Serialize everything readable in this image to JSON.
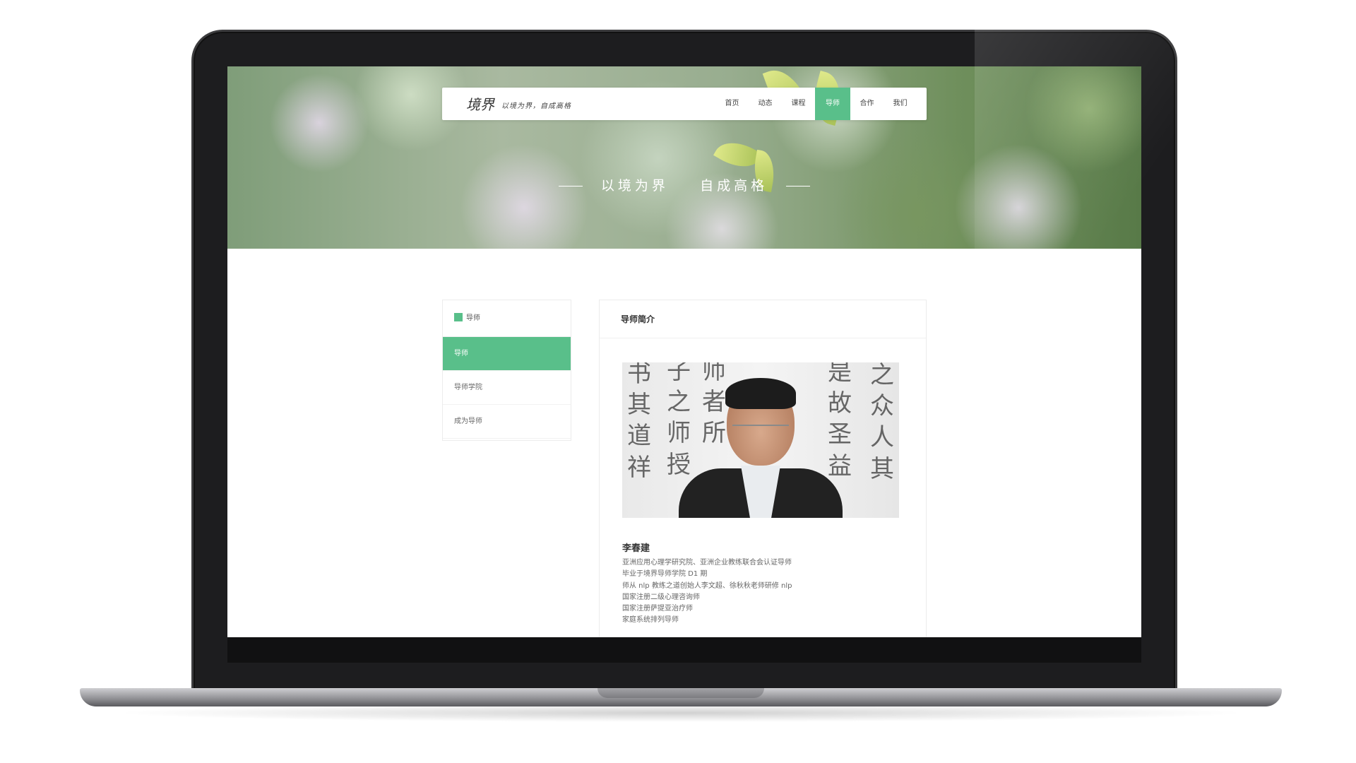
{
  "nav": {
    "logo": "境界",
    "slogan": "以境为界，自成高格",
    "items": [
      {
        "label": "首页",
        "active": false
      },
      {
        "label": "动态",
        "active": false
      },
      {
        "label": "课程",
        "active": false
      },
      {
        "label": "导师",
        "active": true
      },
      {
        "label": "合作",
        "active": false
      },
      {
        "label": "我们",
        "active": false
      }
    ]
  },
  "hero": {
    "tagline_left": "以境为界",
    "tagline_right": "自成高格"
  },
  "sidebar": {
    "heading": "导师",
    "items": [
      {
        "label": "导师",
        "active": true
      },
      {
        "label": "导师学院",
        "active": false
      },
      {
        "label": "成为导师",
        "active": false
      }
    ]
  },
  "panel": {
    "title": "导师简介",
    "mentor_name": "李春建",
    "bio_lines": [
      "亚洲应用心理学研究院、亚洲企业教练联合会认证导师",
      "毕业于境界导师学院 D1 期",
      "师从 nlp 教练之道创始人李文超、徐秋秋老师研修 nlp",
      "国家注册二级心理咨询师",
      "国家注册萨提亚治疗师",
      "家庭系统排列导师"
    ]
  },
  "colors": {
    "accent": "#59bf8a",
    "laptop_frame": "#1d1d1f"
  }
}
